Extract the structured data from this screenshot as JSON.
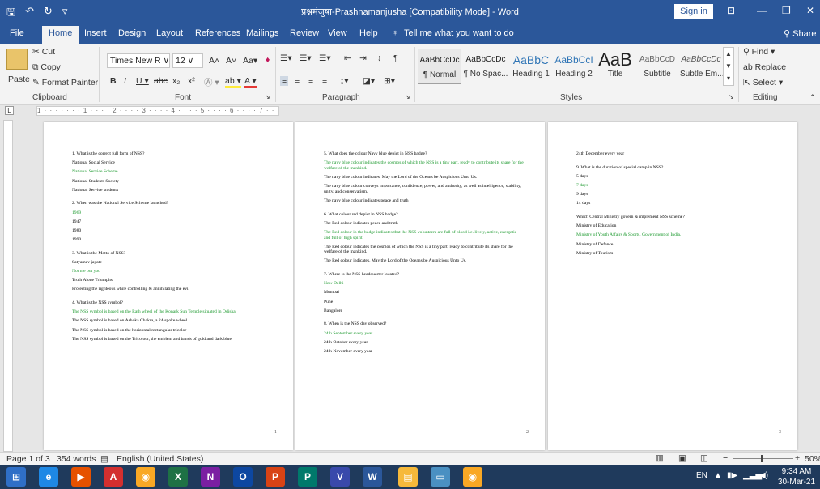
{
  "title": "प्रश्नमंजुषा-Prashnamanjusha [Compatibility Mode] - Word",
  "signin": "Sign in",
  "tabs": [
    "File",
    "Home",
    "Insert",
    "Design",
    "Layout",
    "References",
    "Mailings",
    "Review",
    "View",
    "Help"
  ],
  "tell_me": "Tell me what you want to do",
  "share": "Share",
  "clipboard": {
    "paste": "Paste",
    "cut": "Cut",
    "copy": "Copy",
    "format_painter": "Format Painter",
    "label": "Clipboard"
  },
  "font": {
    "name": "Times New R",
    "size": "12",
    "label": "Font"
  },
  "paragraph_label": "Paragraph",
  "styles": {
    "label": "Styles",
    "items": [
      {
        "sample": "AaBbCcDc",
        "name": "¶ Normal"
      },
      {
        "sample": "AaBbCcDc",
        "name": "¶ No Spac..."
      },
      {
        "sample": "AaBbC",
        "name": "Heading 1"
      },
      {
        "sample": "AaBbCcI",
        "name": "Heading 2"
      },
      {
        "sample": "AaB",
        "name": "Title"
      },
      {
        "sample": "AaBbCcD",
        "name": "Subtitle"
      },
      {
        "sample": "AaBbCcDc",
        "name": "Subtle Em..."
      }
    ]
  },
  "editing": {
    "find": "Find",
    "replace": "Replace",
    "select": "Select",
    "label": "Editing"
  },
  "ruler_marks": "1 · · · · · · · 1 · · · · 2 · · · · 3 · · · · 4 · · · · 5 · · · · 6 · · · · 7 · · ·",
  "pages": [
    {
      "number": "1",
      "lines": [
        {
          "t": "1. What is the correct full form of NSS?",
          "g": false,
          "gap": false
        },
        {
          "t": "National Social Service",
          "g": false,
          "gap": false
        },
        {
          "t": "National Service Scheme",
          "g": true,
          "gap": false
        },
        {
          "t": "National Students Society",
          "g": false,
          "gap": false
        },
        {
          "t": "National Service students",
          "g": false,
          "gap": false
        },
        {
          "t": "2. When was the National Service Scheme launched?",
          "g": false,
          "gap": true
        },
        {
          "t": "1969",
          "g": true,
          "gap": false
        },
        {
          "t": "1947",
          "g": false,
          "gap": false
        },
        {
          "t": "1980",
          "g": false,
          "gap": false
        },
        {
          "t": "1990",
          "g": false,
          "gap": false
        },
        {
          "t": "3. What is the Motto of NSS?",
          "g": false,
          "gap": true
        },
        {
          "t": "Satyamev jayate",
          "g": false,
          "gap": false
        },
        {
          "t": "Not me but you",
          "g": true,
          "gap": false
        },
        {
          "t": "Truth Alone Triumphs",
          "g": false,
          "gap": false
        },
        {
          "t": "Protecting the righteous while controlling & annihilating the evil",
          "g": false,
          "gap": false
        },
        {
          "t": "4. What is the NSS symbol?",
          "g": false,
          "gap": true
        },
        {
          "t": "The NSS symbol is based on the Rath wheel of the Konark Sun Temple situated in Odisha.",
          "g": true,
          "gap": false
        },
        {
          "t": "The NSS symbol is based on Ashoka Chakra, a 24-spoke wheel.",
          "g": false,
          "gap": false
        },
        {
          "t": "The NSS symbol is based on the horizontal rectangular tricolor",
          "g": false,
          "gap": false
        },
        {
          "t": "The NSS symbol is based on the Tricolour, the emblem and bands of gold and dark blue.",
          "g": false,
          "gap": false
        }
      ]
    },
    {
      "number": "2",
      "lines": [
        {
          "t": "5. What does the colour Navy blue depict in NSS badge?",
          "g": false,
          "gap": false
        },
        {
          "t": "The navy blue colour indicates the cosmos of which the NSS is a tiny part, ready to contribute its share for the welfare of the mankind.",
          "g": true,
          "gap": false
        },
        {
          "t": "The navy blue colour indicates, May the Lord of the Oceans be Auspicious Unto Us.",
          "g": false,
          "gap": false
        },
        {
          "t": "The navy blue colour conveys importance, confidence, power, and authority, as well as intelligence, stability, unity, and conservatism.",
          "g": false,
          "gap": false
        },
        {
          "t": "The navy blue colour indicates peace and truth",
          "g": false,
          "gap": false
        },
        {
          "t": "6. What colour red depict in NSS badge?",
          "g": false,
          "gap": true
        },
        {
          "t": "The Red colour indicates peace and truth",
          "g": false,
          "gap": false
        },
        {
          "t": "The Red colour in the badge indicates that the NSS volunteers are full of blood i.e. lively, active, energetic and full of high spirit.",
          "g": true,
          "gap": false
        },
        {
          "t": "The Red colour indicates the cosmos of which the NSS is a tiny part, ready to contribute its share for the welfare of the mankind.",
          "g": false,
          "gap": false
        },
        {
          "t": "The Red colour indicates, May the Lord of the Oceans be Auspicious Unto Us.",
          "g": false,
          "gap": false
        },
        {
          "t": "7. Where is the NSS headquarter located?",
          "g": false,
          "gap": true
        },
        {
          "t": "New Delhi",
          "g": true,
          "gap": false
        },
        {
          "t": "Mumbai",
          "g": false,
          "gap": false
        },
        {
          "t": "Pune",
          "g": false,
          "gap": false
        },
        {
          "t": "Bangalore",
          "g": false,
          "gap": false
        },
        {
          "t": "8. When is the NSS day observed?",
          "g": false,
          "gap": true
        },
        {
          "t": "24th September every year",
          "g": true,
          "gap": false
        },
        {
          "t": "24th October every year",
          "g": false,
          "gap": false
        },
        {
          "t": "24th November every year",
          "g": false,
          "gap": false
        }
      ]
    },
    {
      "number": "3",
      "lines": [
        {
          "t": "24th December every year",
          "g": false,
          "gap": false
        },
        {
          "t": "9. What is the duration of special camp in NSS?",
          "g": false,
          "gap": true
        },
        {
          "t": "5 days",
          "g": false,
          "gap": false
        },
        {
          "t": "7 days",
          "g": true,
          "gap": false
        },
        {
          "t": "9 days",
          "g": false,
          "gap": false
        },
        {
          "t": "14 days",
          "g": false,
          "gap": false
        },
        {
          "t": "Which Central Ministry govern & implement NSS scheme?",
          "g": false,
          "gap": true
        },
        {
          "t": "Ministry of Education",
          "g": false,
          "gap": false
        },
        {
          "t": "Ministry of Youth Affairs & Sports, Government of India.",
          "g": true,
          "gap": false
        },
        {
          "t": "Ministry of Defence",
          "g": false,
          "gap": false
        },
        {
          "t": "Ministry of Tourism",
          "g": false,
          "gap": false
        }
      ]
    }
  ],
  "status": {
    "page": "Page 1 of 3",
    "words": "354 words",
    "language": "English (United States)",
    "zoom": "50%"
  },
  "tray": {
    "lang": "EN",
    "time": "9:34 AM",
    "date": "30-Mar-21"
  },
  "taskbar_apps": [
    {
      "name": "start-button",
      "label": "⊞",
      "color": "#2f6fc7"
    },
    {
      "name": "edge-app",
      "label": "e",
      "color": "#1e88e5"
    },
    {
      "name": "media-player-app",
      "label": "▶",
      "color": "#e65100"
    },
    {
      "name": "acrobat-app",
      "label": "A",
      "color": "#d32f2f"
    },
    {
      "name": "chrome-app",
      "label": "◉",
      "color": "#f9a825"
    },
    {
      "name": "excel-app",
      "label": "X",
      "color": "#1e7145"
    },
    {
      "name": "onenote-app",
      "label": "N",
      "color": "#7b1fa2"
    },
    {
      "name": "outlook-app",
      "label": "O",
      "color": "#0d47a1"
    },
    {
      "name": "powerpoint-app",
      "label": "P",
      "color": "#d84315"
    },
    {
      "name": "publisher-app",
      "label": "P",
      "color": "#00796b"
    },
    {
      "name": "visio-app",
      "label": "V",
      "color": "#3949ab"
    },
    {
      "name": "word-app",
      "label": "W",
      "color": "#2b579a"
    },
    {
      "name": "file-explorer-app",
      "label": "▤",
      "color": "#f6b93b"
    },
    {
      "name": "desktop-app",
      "label": "▭",
      "color": "#4a90c2"
    },
    {
      "name": "chrome-app-2",
      "label": "◉",
      "color": "#f9a825"
    }
  ]
}
